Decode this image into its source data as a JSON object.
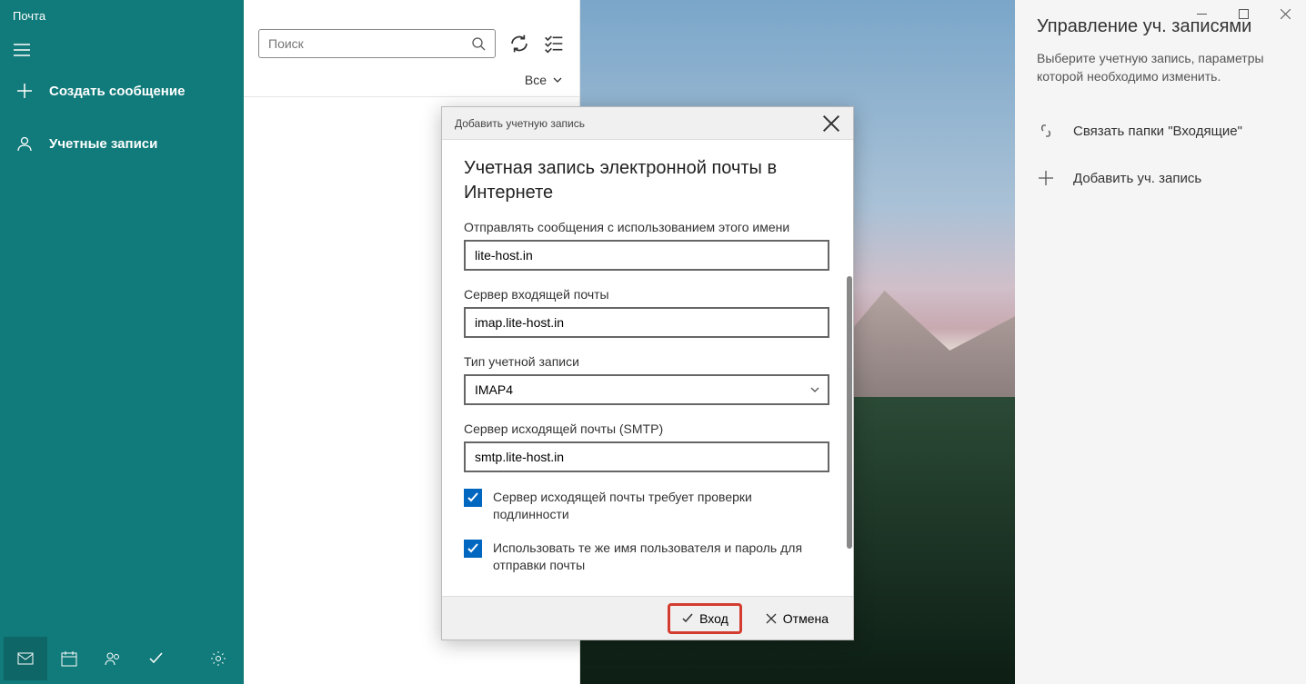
{
  "app_title": "Почта",
  "sidebar": {
    "compose": "Создать сообщение",
    "accounts": "Учетные записи"
  },
  "search": {
    "placeholder": "Поиск"
  },
  "filter": {
    "all": "Все"
  },
  "right_panel": {
    "title": "Управление уч. записями",
    "subtitle": "Выберите учетную запись, параметры которой необходимо изменить.",
    "link_inboxes": "Связать папки \"Входящие\"",
    "add_account": "Добавить уч. запись"
  },
  "dialog": {
    "titlebar": "Добавить учетную запись",
    "heading": "Учетная запись электронной почты в Интернете",
    "fields": {
      "send_name": {
        "label": "Отправлять сообщения с использованием этого имени",
        "value": "lite-host.in"
      },
      "incoming": {
        "label": "Сервер входящей почты",
        "value": "imap.lite-host.in"
      },
      "acct_type": {
        "label": "Тип учетной записи",
        "value": "IMAP4"
      },
      "outgoing": {
        "label": "Сервер исходящей почты (SMTP)",
        "value": "smtp.lite-host.in"
      }
    },
    "checks": {
      "auth": "Сервер исходящей почты требует проверки подлинности",
      "same_creds": "Использовать те же имя пользователя и пароль для отправки почты"
    },
    "buttons": {
      "signin": "Вход",
      "cancel": "Отмена"
    }
  }
}
